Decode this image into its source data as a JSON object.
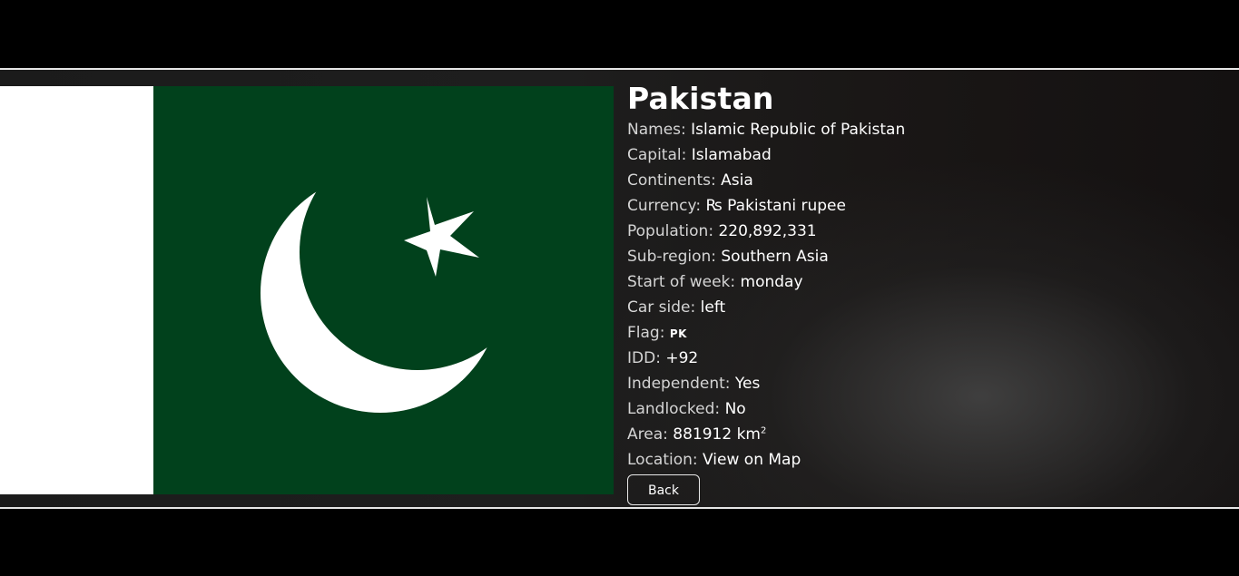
{
  "country": {
    "name": "Pakistan",
    "flag_alt": "Flag of Pakistan",
    "flag_colors": {
      "white": "#ffffff",
      "green": "#01411c"
    }
  },
  "details": {
    "names": {
      "label": "Names:",
      "value": "Islamic Republic of Pakistan"
    },
    "capital": {
      "label": "Capital:",
      "value": "Islamabad"
    },
    "continents": {
      "label": "Continents:",
      "value": "Asia"
    },
    "currency": {
      "label": "Currency:",
      "value": "₨ Pakistani rupee"
    },
    "population": {
      "label": "Population:",
      "value": "220,892,331"
    },
    "subregion": {
      "label": "Sub-region:",
      "value": "Southern Asia"
    },
    "start_of_week": {
      "label": "Start of week:",
      "value": "monday"
    },
    "car_side": {
      "label": "Car side:",
      "value": "left"
    },
    "flag": {
      "label": "Flag:",
      "value": "PK"
    },
    "idd": {
      "label": "IDD:",
      "value": "+92"
    },
    "independent": {
      "label": "Independent:",
      "value": "Yes"
    },
    "landlocked": {
      "label": "Landlocked:",
      "value": "No"
    },
    "area": {
      "label": "Area:",
      "value": "881912 km",
      "unit_sup": "2"
    },
    "location": {
      "label": "Location:",
      "link_text": "View on Map"
    }
  },
  "actions": {
    "back_label": "Back"
  },
  "colors": {
    "background": "#000000",
    "band_border": "#e6e6e6",
    "text": "#ffffff",
    "label_text": "#d4d4d4"
  }
}
